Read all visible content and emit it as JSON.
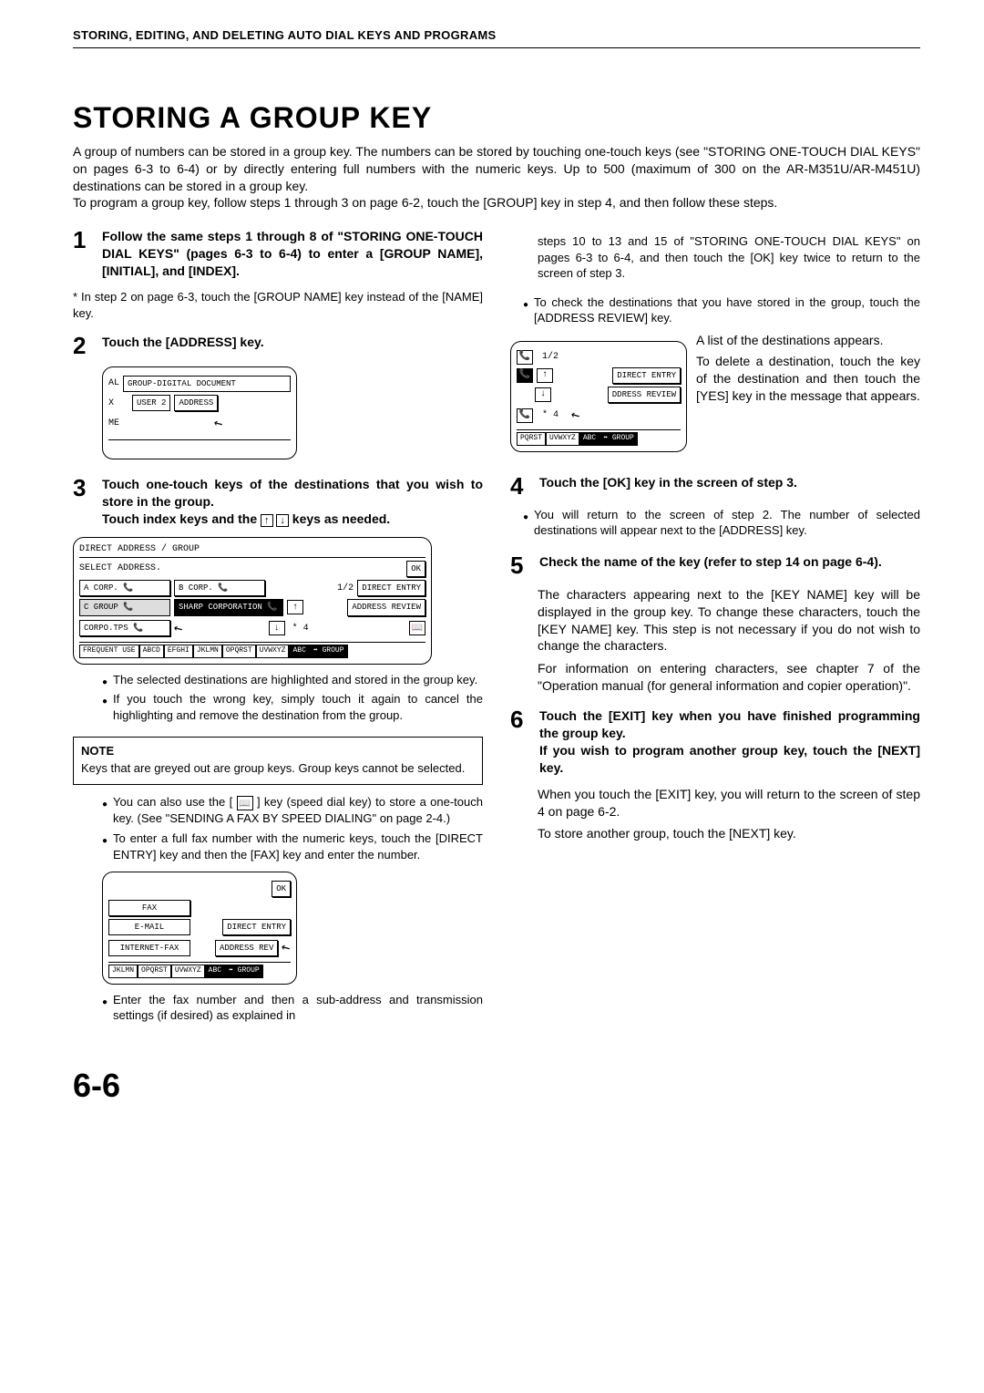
{
  "header": "STORING, EDITING, AND DELETING AUTO DIAL KEYS AND PROGRAMS",
  "title": "STORING A GROUP KEY",
  "intro": "A group of numbers can be stored in a group key. The numbers can be stored by touching one-touch keys (see \"STORING ONE-TOUCH DIAL KEYS\" on pages 6-3 to 6-4) or by directly entering full numbers with the numeric keys. Up to 500 (maximum of 300 on the AR-M351U/AR-M451U) destinations can be stored in a group key.\nTo program a group key, follow steps 1 through 3 on page 6-2, touch the [GROUP] key in step 4, and then follow these steps.",
  "left": {
    "s1": "Follow the same steps 1 through 8 of \"STORING ONE-TOUCH DIAL KEYS\" (pages 6-3 to 6-4) to enter a [GROUP NAME], [INITIAL], and [INDEX].",
    "s1note": "* In step 2 on page 6-3, touch the [GROUP NAME] key instead of the [NAME] key.",
    "s2": "Touch the [ADDRESS] key.",
    "s3": "Touch one-touch keys of the destinations that you wish to store in the group.",
    "s3b": "Touch index keys and the ",
    "s3c": " keys as needed.",
    "b1": "The selected destinations are highlighted and stored in the group key.",
    "b2": "If you touch the wrong key, simply touch it again to cancel the highlighting and remove the destination from the group.",
    "note_title": "NOTE",
    "note_body": "Keys that are greyed out are group keys. Group keys cannot be selected.",
    "b3a": "You can also use the [",
    "b3b": "] key (speed dial key) to store a one-touch key. (See \"SENDING A FAX BY SPEED DIALING\" on page 2-4.)",
    "b4": "To enter a full fax number with the numeric keys, touch the [DIRECT ENTRY] key and then the [FAX] key and enter the number.",
    "b5": "Enter the fax number and then a sub-address and transmission settings (if desired) as explained in",
    "fig2": {
      "al": "AL",
      "gd": "GROUP-DIGITAL DOCUMENT",
      "x": "X",
      "user": "USER 2",
      "addr": "ADDRESS",
      "me": "ME"
    },
    "fig3": {
      "title": "DIRECT ADDRESS / GROUP",
      "sub": "SELECT ADDRESS.",
      "ok": "OK",
      "a": "A CORP.",
      "b": "B CORP.",
      "c": "C GROUP",
      "sharp": "SHARP CORPORATION",
      "corpo": "CORPO.TPS",
      "pg": "1/2",
      "de": "DIRECT ENTRY",
      "ar": "ADDRESS REVIEW",
      "star": "* 4",
      "tabs": [
        "FREQUENT USE",
        "ABCD",
        "EFGHI",
        "JKLMN",
        "OPQRST",
        "UVWXYZ",
        "ABC",
        "⬌ GROUP"
      ]
    },
    "fig4": {
      "ok": "OK",
      "fax": "FAX",
      "email": "E-MAIL",
      "ifax": "INTERNET-FAX",
      "de": "DIRECT ENTRY",
      "ar": "ADDRESS REV",
      "tabs": [
        "JKLMN",
        "OPQRST",
        "UVWXYZ",
        "ABC",
        "⬌ GROUP"
      ]
    }
  },
  "right": {
    "cont": "steps 10 to 13 and 15 of \"STORING ONE-TOUCH DIAL KEYS\" on pages 6-3 to 6-4, and then touch the [OK] key twice to return to the screen of step 3.",
    "b1": "To check the destinations that you have stored in the group, touch the [ADDRESS REVIEW] key.",
    "side1": "A list of the destinations appears.",
    "side2": "To delete a destination, touch the key of the destination and then touch the [YES] key in the message that appears.",
    "s4": "Touch the [OK] key in the screen of step 3.",
    "b4": "You will return to the screen of step 2. The number of selected destinations will appear next to the [ADDRESS] key.",
    "s5": "Check the name of the key (refer to step 14 on page 6-4).",
    "p5a": "The characters appearing next to the [KEY NAME] key will be displayed in the group key. To change these characters, touch the [KEY NAME] key. This step is not necessary if you do not wish to change the characters.",
    "p5b": "For information on entering characters, see chapter 7 of the \"Operation manual (for general information and copier operation)\".",
    "s6a": "Touch the [EXIT] key when you have finished programming the group key.",
    "s6b": "If you wish to program another group key, touch the [NEXT] key.",
    "p6a": "When you touch the [EXIT] key, you will return to the screen of step 4 on page 6-2.",
    "p6b": "To store another group, touch the [NEXT] key.",
    "fig": {
      "pg": "1/2",
      "de": "DIRECT ENTRY",
      "ar": "DDRESS REVIEW",
      "star": "* 4",
      "tabs": [
        "PQRST",
        "UVWXYZ",
        "ABC",
        "⬌ GROUP"
      ]
    }
  },
  "page": "6-6"
}
